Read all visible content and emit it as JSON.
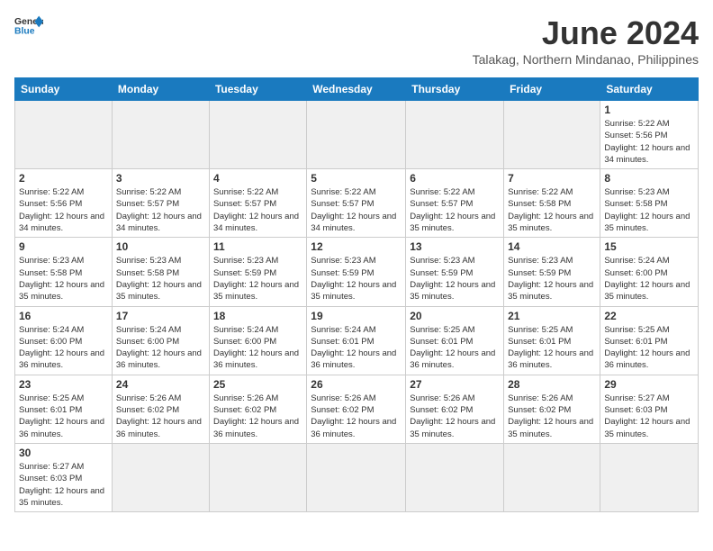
{
  "header": {
    "logo_general": "General",
    "logo_blue": "Blue",
    "month_title": "June 2024",
    "subtitle": "Talakag, Northern Mindanao, Philippines"
  },
  "columns": [
    "Sunday",
    "Monday",
    "Tuesday",
    "Wednesday",
    "Thursday",
    "Friday",
    "Saturday"
  ],
  "weeks": [
    [
      {
        "day": "",
        "info": ""
      },
      {
        "day": "",
        "info": ""
      },
      {
        "day": "",
        "info": ""
      },
      {
        "day": "",
        "info": ""
      },
      {
        "day": "",
        "info": ""
      },
      {
        "day": "",
        "info": ""
      },
      {
        "day": "1",
        "info": "Sunrise: 5:22 AM\nSunset: 5:56 PM\nDaylight: 12 hours and 34 minutes."
      }
    ],
    [
      {
        "day": "2",
        "info": "Sunrise: 5:22 AM\nSunset: 5:56 PM\nDaylight: 12 hours and 34 minutes."
      },
      {
        "day": "3",
        "info": "Sunrise: 5:22 AM\nSunset: 5:57 PM\nDaylight: 12 hours and 34 minutes."
      },
      {
        "day": "4",
        "info": "Sunrise: 5:22 AM\nSunset: 5:57 PM\nDaylight: 12 hours and 34 minutes."
      },
      {
        "day": "5",
        "info": "Sunrise: 5:22 AM\nSunset: 5:57 PM\nDaylight: 12 hours and 34 minutes."
      },
      {
        "day": "6",
        "info": "Sunrise: 5:22 AM\nSunset: 5:57 PM\nDaylight: 12 hours and 35 minutes."
      },
      {
        "day": "7",
        "info": "Sunrise: 5:22 AM\nSunset: 5:58 PM\nDaylight: 12 hours and 35 minutes."
      },
      {
        "day": "8",
        "info": "Sunrise: 5:23 AM\nSunset: 5:58 PM\nDaylight: 12 hours and 35 minutes."
      }
    ],
    [
      {
        "day": "9",
        "info": "Sunrise: 5:23 AM\nSunset: 5:58 PM\nDaylight: 12 hours and 35 minutes."
      },
      {
        "day": "10",
        "info": "Sunrise: 5:23 AM\nSunset: 5:58 PM\nDaylight: 12 hours and 35 minutes."
      },
      {
        "day": "11",
        "info": "Sunrise: 5:23 AM\nSunset: 5:59 PM\nDaylight: 12 hours and 35 minutes."
      },
      {
        "day": "12",
        "info": "Sunrise: 5:23 AM\nSunset: 5:59 PM\nDaylight: 12 hours and 35 minutes."
      },
      {
        "day": "13",
        "info": "Sunrise: 5:23 AM\nSunset: 5:59 PM\nDaylight: 12 hours and 35 minutes."
      },
      {
        "day": "14",
        "info": "Sunrise: 5:23 AM\nSunset: 5:59 PM\nDaylight: 12 hours and 35 minutes."
      },
      {
        "day": "15",
        "info": "Sunrise: 5:24 AM\nSunset: 6:00 PM\nDaylight: 12 hours and 35 minutes."
      }
    ],
    [
      {
        "day": "16",
        "info": "Sunrise: 5:24 AM\nSunset: 6:00 PM\nDaylight: 12 hours and 36 minutes."
      },
      {
        "day": "17",
        "info": "Sunrise: 5:24 AM\nSunset: 6:00 PM\nDaylight: 12 hours and 36 minutes."
      },
      {
        "day": "18",
        "info": "Sunrise: 5:24 AM\nSunset: 6:00 PM\nDaylight: 12 hours and 36 minutes."
      },
      {
        "day": "19",
        "info": "Sunrise: 5:24 AM\nSunset: 6:01 PM\nDaylight: 12 hours and 36 minutes."
      },
      {
        "day": "20",
        "info": "Sunrise: 5:25 AM\nSunset: 6:01 PM\nDaylight: 12 hours and 36 minutes."
      },
      {
        "day": "21",
        "info": "Sunrise: 5:25 AM\nSunset: 6:01 PM\nDaylight: 12 hours and 36 minutes."
      },
      {
        "day": "22",
        "info": "Sunrise: 5:25 AM\nSunset: 6:01 PM\nDaylight: 12 hours and 36 minutes."
      }
    ],
    [
      {
        "day": "23",
        "info": "Sunrise: 5:25 AM\nSunset: 6:01 PM\nDaylight: 12 hours and 36 minutes."
      },
      {
        "day": "24",
        "info": "Sunrise: 5:26 AM\nSunset: 6:02 PM\nDaylight: 12 hours and 36 minutes."
      },
      {
        "day": "25",
        "info": "Sunrise: 5:26 AM\nSunset: 6:02 PM\nDaylight: 12 hours and 36 minutes."
      },
      {
        "day": "26",
        "info": "Sunrise: 5:26 AM\nSunset: 6:02 PM\nDaylight: 12 hours and 36 minutes."
      },
      {
        "day": "27",
        "info": "Sunrise: 5:26 AM\nSunset: 6:02 PM\nDaylight: 12 hours and 35 minutes."
      },
      {
        "day": "28",
        "info": "Sunrise: 5:26 AM\nSunset: 6:02 PM\nDaylight: 12 hours and 35 minutes."
      },
      {
        "day": "29",
        "info": "Sunrise: 5:27 AM\nSunset: 6:03 PM\nDaylight: 12 hours and 35 minutes."
      }
    ],
    [
      {
        "day": "30",
        "info": "Sunrise: 5:27 AM\nSunset: 6:03 PM\nDaylight: 12 hours and 35 minutes."
      },
      {
        "day": "",
        "info": ""
      },
      {
        "day": "",
        "info": ""
      },
      {
        "day": "",
        "info": ""
      },
      {
        "day": "",
        "info": ""
      },
      {
        "day": "",
        "info": ""
      },
      {
        "day": "",
        "info": ""
      }
    ]
  ]
}
